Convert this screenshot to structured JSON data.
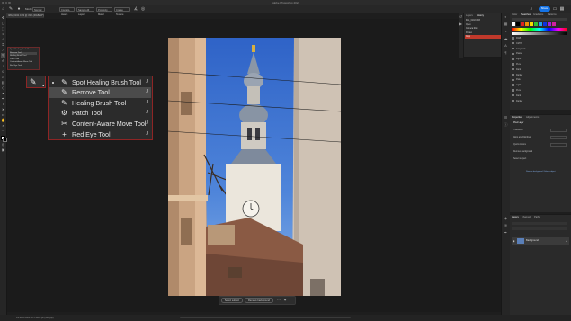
{
  "window": {
    "title": "Adobe Photoshop 2024"
  },
  "options_bar": {
    "mode_label": "Mode:",
    "mode_value": "Normal",
    "buttons": [
      "Content-Aware",
      "Sample All Layers",
      "Proximity Match",
      "Create Texture",
      "Sample All Layers"
    ],
    "share_label": "Share"
  },
  "document_tab": {
    "title": "IMG_0102.CR3 @ 33% (RGB/16*)"
  },
  "tool_flyout": {
    "items": [
      {
        "icon": "spot-healing-brush-icon",
        "glyph": "✎",
        "label": "Spot Healing Brush Tool",
        "shortcut": "J",
        "active": true
      },
      {
        "icon": "remove-tool-icon",
        "glyph": "✎",
        "label": "Remove Tool",
        "shortcut": "J"
      },
      {
        "icon": "healing-brush-icon",
        "glyph": "✎",
        "label": "Healing Brush Tool",
        "shortcut": "J"
      },
      {
        "icon": "patch-tool-icon",
        "glyph": "⚙",
        "label": "Patch Tool",
        "shortcut": "J"
      },
      {
        "icon": "content-aware-move-icon",
        "glyph": "✂",
        "label": "Content-Aware Move Tool",
        "shortcut": "J"
      },
      {
        "icon": "red-eye-icon",
        "glyph": "+",
        "label": "Red Eye Tool",
        "shortcut": "J"
      }
    ]
  },
  "mini_flyout": {
    "items": [
      "Spot Healing Brush Tool",
      "Remove Tool",
      "Healing Brush Tool",
      "Patch Tool",
      "Content-Aware Move Tool",
      "Red Eye Tool"
    ]
  },
  "context_bar": {
    "select_subject": "Select subject",
    "remove_background": "Remove background"
  },
  "history_panel": {
    "tabs": [
      "Layers",
      "History"
    ],
    "rows": [
      "IMG_0102.CR3",
      "Open",
      "Camera Raw",
      "Flatten",
      "Crop"
    ]
  },
  "swatches_panel": {
    "tabs": [
      "Color",
      "Swatches",
      "Gradients",
      "Patterns"
    ],
    "top_colors": [
      "#ffffff",
      "#000000",
      "#e02020",
      "#f09000",
      "#f8e000",
      "#30c030",
      "#20a0f0",
      "#1030e0",
      "#a020e0",
      "#d020a0"
    ],
    "folders": [
      "RGB",
      "CMYK",
      "Grayscale",
      "Pastel",
      "Light",
      "Pure",
      "Dark",
      "Darker",
      "Pale",
      "Light",
      "Pure",
      "Dark",
      "Darker"
    ]
  },
  "properties_panel": {
    "tabs": [
      "Properties",
      "Adjustments"
    ],
    "title": "Pixel Layer",
    "rows": [
      "Transform",
      "Align and Distribute",
      "Quick Actions",
      "Remove background",
      "Select subject"
    ],
    "footer": "Remove background / Select subject"
  },
  "layers_panel": {
    "tabs": [
      "Layers",
      "Channels",
      "Paths"
    ],
    "layer_name": "Background"
  },
  "status_bar": {
    "text": "33.33%   6000 px x 4000 px (300 ppi)"
  },
  "accent_colors": {
    "share_blue": "#1473e6",
    "callout_red": "#8e2525",
    "history_selected": "#c0392b"
  }
}
